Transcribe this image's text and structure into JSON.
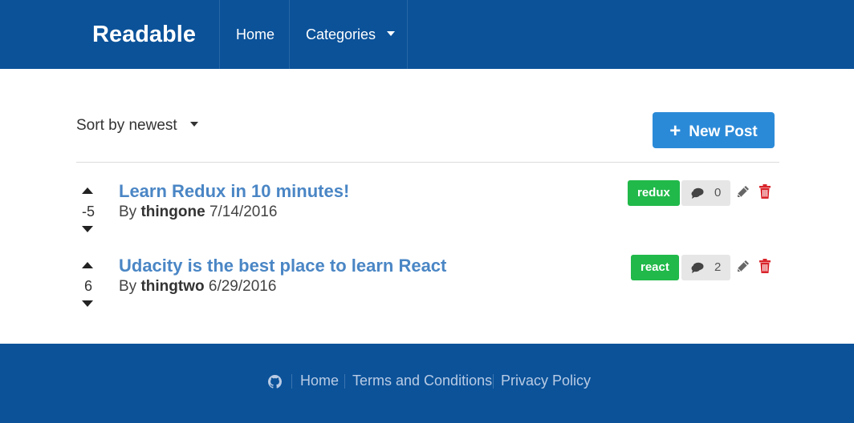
{
  "header": {
    "brand": "Readable",
    "nav": {
      "home": "Home",
      "categories": "Categories"
    },
    "background": "#0b5299"
  },
  "toolbar": {
    "sort_label": "Sort by newest",
    "new_post_label": "New Post",
    "new_post_color": "#2b8ad8"
  },
  "posts": [
    {
      "score": "-5",
      "title": "Learn Redux in 10 minutes!",
      "by": "By",
      "author": "thingone",
      "date": "7/14/2016",
      "category": "redux",
      "comment_count": "0"
    },
    {
      "score": "6",
      "title": "Udacity is the best place to learn React",
      "by": "By",
      "author": "thingtwo",
      "date": "6/29/2016",
      "category": "react",
      "comment_count": "2"
    }
  ],
  "colors": {
    "category_badge": "#21b94a",
    "delete": "#d9242b",
    "title_link": "#4a86c5"
  },
  "footer": {
    "links": {
      "home": "Home",
      "terms": "Terms and Conditions",
      "privacy": "Privacy Policy"
    },
    "icon": "github-icon"
  }
}
